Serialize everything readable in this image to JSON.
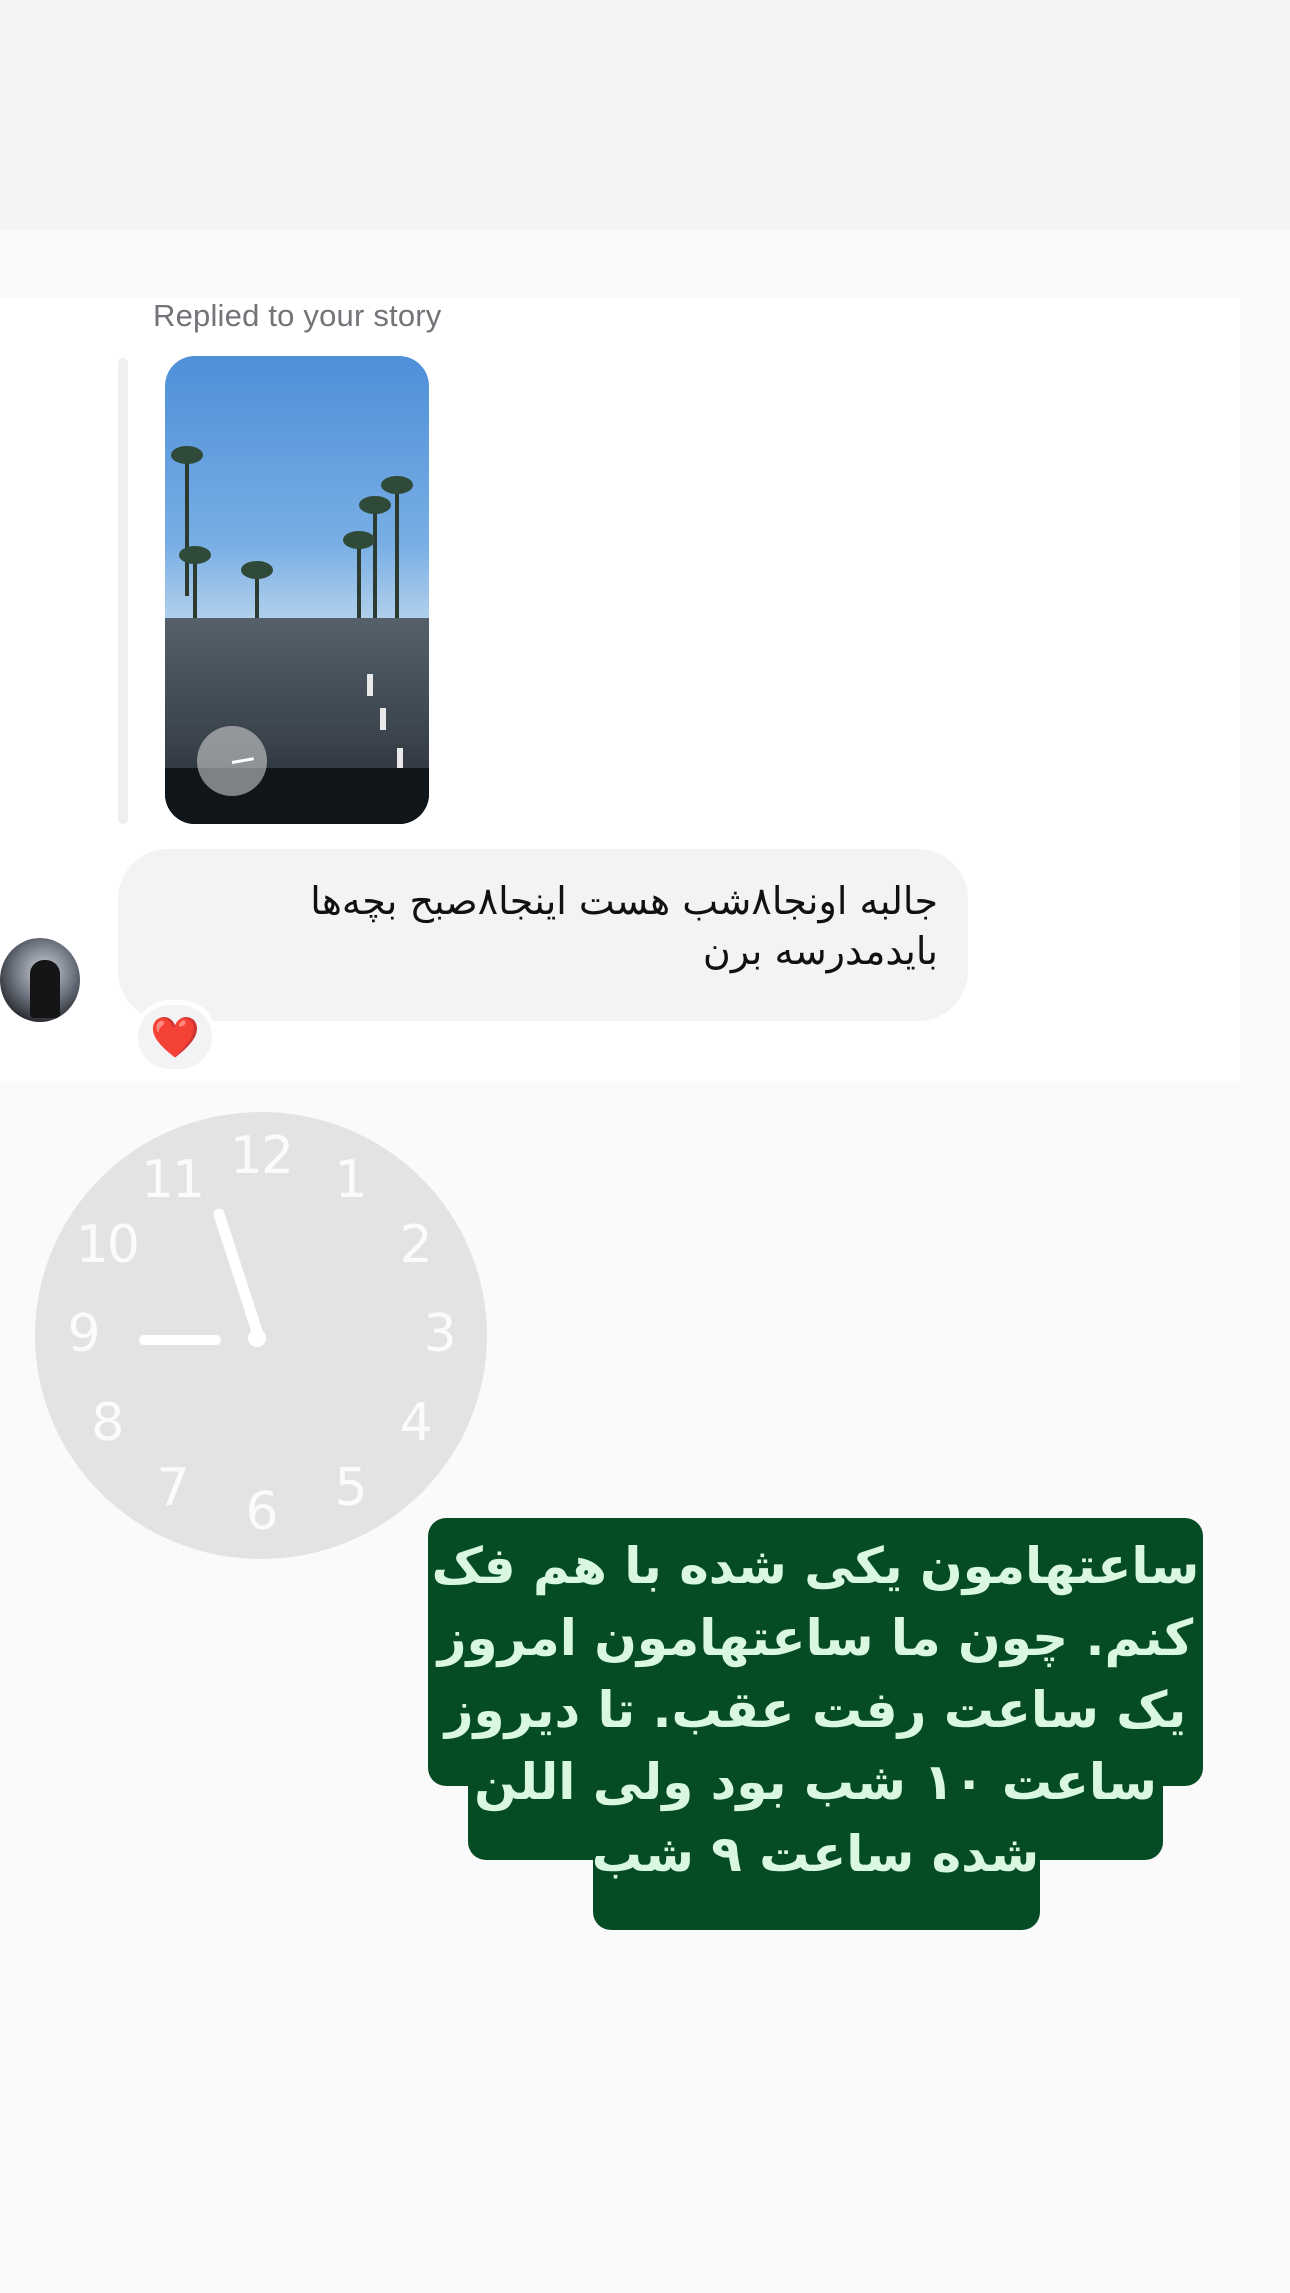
{
  "story": {
    "reply_header": "Replied to your story",
    "message_text": "جالبه اونجا۸شب هست اینجا۸صبح بچه‌ها بایدمدرسه برن",
    "reaction": "❤️",
    "clock_numbers": [
      "12",
      "1",
      "2",
      "3",
      "4",
      "5",
      "6",
      "7",
      "8",
      "9",
      "10",
      "11"
    ],
    "caption_lines": [
      "ساعتهامون یکی شده با هم فک",
      "کنم. چون ما ساعتهامون امروز",
      "یک ساعت رفت عقب. تا دیروز",
      "ساعت ۱۰ شب بود ولی اللن",
      "شده ساعت ۹ شب"
    ],
    "colors": {
      "caption_bg": "#054c25",
      "caption_text": "#d9f8df",
      "clock_face": "#e3e3e4",
      "bubble": "#f3f3f5",
      "reaction": "#e0242f"
    },
    "icons": [
      "heart-reaction-icon",
      "analog-clock-sticker"
    ]
  }
}
